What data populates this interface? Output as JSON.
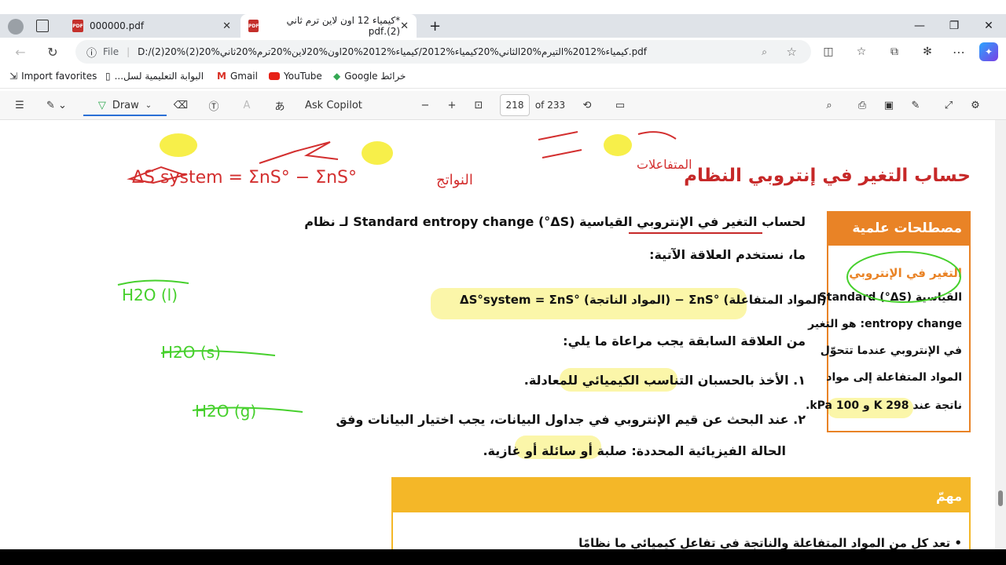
{
  "tabs": [
    {
      "label": "000000.pdf",
      "close": "✕"
    },
    {
      "label": "*كيمياء 12 اون لاين ترم ثاني (2).pdf",
      "close": "✕"
    }
  ],
  "new_tab": "+",
  "window": {
    "minimize": "—",
    "restore": "❐",
    "close": "✕"
  },
  "address": {
    "scheme_label": "File",
    "url": "D:/(2)20%كيمياء%2012%التيرم%20الثاني%20كيمياء%2012/كيمياء%2012%20اون%20لاين%20ترم%20ثاني%20(2).pdf"
  },
  "favorites": [
    {
      "label": "Import favorites"
    },
    {
      "label": "البوابة التعليمية لسل..."
    },
    {
      "label": "Gmail"
    },
    {
      "label": "YouTube"
    },
    {
      "label": "Google خرائط"
    }
  ],
  "pdf_toolbar": {
    "draw_label": "Draw",
    "ask_copilot": "Ask Copilot",
    "page_current": "218",
    "page_total": "of 233",
    "zoom_out": "−",
    "zoom_in": "+"
  },
  "page": {
    "heading": "حساب التغير في إنتروبي النظام",
    "para1_line1": "لحساب التغير في الإنتروبي القياسية (ΔS°) Standard entropy change لـ نظام",
    "para1_line2": "ما، نستخدم العلاقة الآتية:",
    "equation": "ΔS°system = ΣnS° (المواد الناتجة) − ΣnS° (المواد المتفاعلة)",
    "para2": "من العلاقة السابقة يجب مراعاة ما يلي:",
    "item1": "١. الأخذ بالحسبان التناسب الكيميائي للمعادلة.",
    "item2_line1": "٢. عند البحث عن قيم الإنتروبي في جداول البيانات، يجب اختيار البيانات وفق",
    "item2_line2": "الحالة الفيزيائية المحددة: صلبة أو سائلة أو غازية.",
    "note_title": "مهمّ",
    "note_text": "• تعد كل من المواد المتفاعلة والناتجة في تفاعل كيميائي ما نظامًا"
  },
  "sidebox": {
    "title": "مصطلحات علمية",
    "l1": "التغير في الإنتروبي",
    "l2": "القياسية (ΔS°) Standard",
    "l3": "entropy change: هو التغير",
    "l4": "في الإنتروبي عندما تتحوّل",
    "l5": "المواد المتفاعلة إلى مواد",
    "l6": "ناتجة عند 298 K و 100 kPa."
  },
  "annotations": {
    "red_top": "ΔS system = ΣnS° − ΣnS°",
    "red_products": "النواتج",
    "red_reactants": "المتفاعلات",
    "green_1": "H2O (l)",
    "green_2": "H2O (s)",
    "green_3": "H2O (g)"
  },
  "colors": {
    "accent_orange": "#e98326",
    "note_yellow": "#f4b728",
    "highlight": "#fbf5a0",
    "heading_red": "#c62828",
    "ink_red": "#d32f2f",
    "ink_green": "#46d02c"
  }
}
